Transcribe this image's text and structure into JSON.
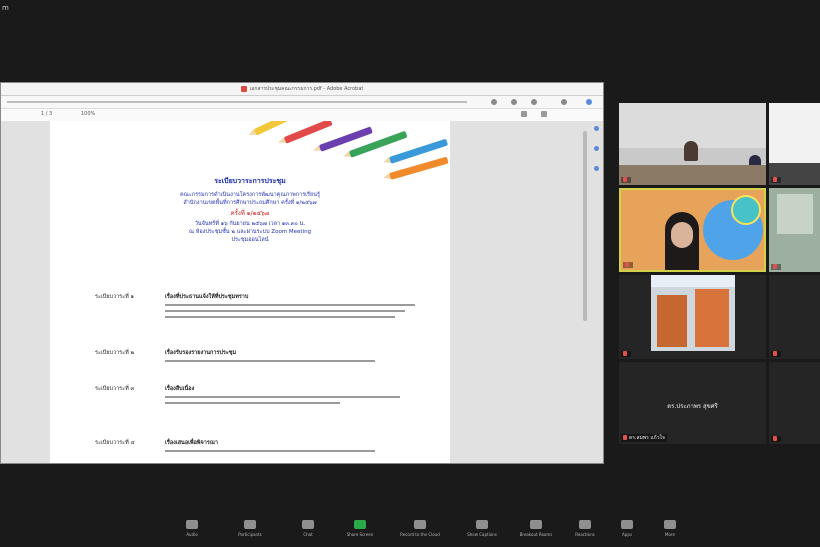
{
  "app": {
    "title_label": "m"
  },
  "shared_screen": {
    "window_title": "เอกสารประชุมคณะกรรมการ.pdf - Adobe Acrobat",
    "page_indicator": "1 / 3",
    "zoom": "100%",
    "document": {
      "heading": "ระเบียบวาระการประชุม",
      "subheading_lines": [
        "คณะกรรมการดำเนินงานโครงการพัฒนาคุณภาพการเรียนรู้",
        "สำนักงานเขตพื้นที่การศึกษาประถมศึกษา ครั้งที่ ๑/๒๕๖๗"
      ],
      "session_line": "ครั้งที่ ๑/๒๕๖๗",
      "meeting_lines": [
        "วันจันทร์ที่ ๑๖ กันยายน ๒๕๖๗ เวลา ๑๓.๓๐ น.",
        "ณ ห้องประชุมชั้น ๒ และผ่านระบบ Zoom Meeting",
        "ประชุมออนไลน์"
      ],
      "agenda": [
        {
          "label": "ระเบียบวาระที่ ๑",
          "title": "เรื่องที่ประธานแจ้งให้ที่ประชุมทราบ"
        },
        {
          "label": "ระเบียบวาระที่ ๒",
          "title": "เรื่องรับรองรายงานการประชุม"
        },
        {
          "label": "ระเบียบวาระที่ ๓",
          "title": "เรื่องสืบเนื่อง"
        },
        {
          "label": "ระเบียบวาระที่ ๔",
          "title": "เรื่องเสนอเพื่อพิจารณา"
        }
      ]
    }
  },
  "gallery": {
    "tiles": [
      {
        "name": ""
      },
      {
        "name": ""
      },
      {
        "name": ""
      },
      {
        "name": ""
      },
      {
        "name": ""
      },
      {
        "name": ""
      },
      {
        "name": ""
      },
      {
        "name": "ดร.สมพร แก้วใจ",
        "center_name": "ดร.ประภาพร สุขศรี"
      },
      {
        "name": ""
      },
      {
        "name": ""
      }
    ]
  },
  "controls": [
    {
      "label": "Audio",
      "icon": "microphone-icon"
    },
    {
      "label": "Participants",
      "icon": "participants-icon"
    },
    {
      "label": "Chat",
      "icon": "chat-icon"
    },
    {
      "label": "Share Screen",
      "icon": "share-screen-icon",
      "color": "#2aa84a"
    },
    {
      "label": "Record to the Cloud",
      "icon": "record-icon"
    },
    {
      "label": "Show Captions",
      "icon": "captions-icon"
    },
    {
      "label": "Breakout Rooms",
      "icon": "breakout-rooms-icon"
    },
    {
      "label": "Reactions",
      "icon": "reactions-icon"
    },
    {
      "label": "Apps",
      "icon": "apps-icon"
    },
    {
      "label": "More",
      "icon": "more-icon"
    }
  ]
}
